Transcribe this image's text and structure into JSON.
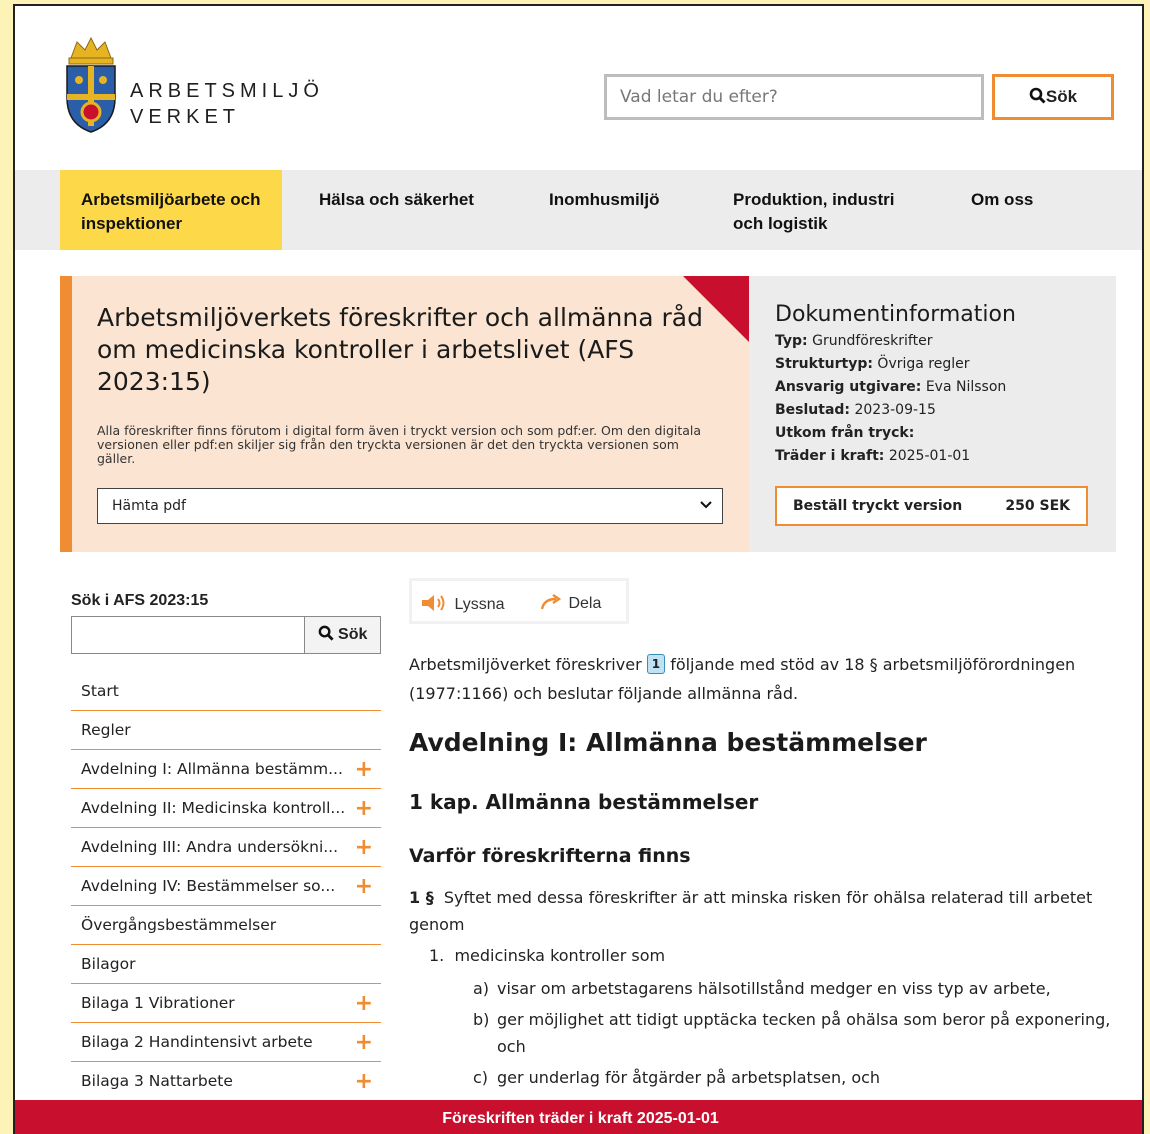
{
  "header": {
    "logo_line1": "ARBETSMILJÖ",
    "logo_line2": "VERKET",
    "search_placeholder": "Vad letar du efter?",
    "search_button": "Sök"
  },
  "nav": {
    "items": [
      {
        "label": "Arbetsmiljöarbete och inspektioner",
        "active": true
      },
      {
        "label": "Hälsa och säkerhet"
      },
      {
        "label": "Inomhusmiljö"
      },
      {
        "label": "Produktion, industri och logistik"
      },
      {
        "label": "Om oss"
      }
    ]
  },
  "document": {
    "title": "Arbetsmiljöverkets föreskrifter och allmänna råd om medicinska kontroller i arbetslivet (AFS 2023:15)",
    "note": "Alla föreskrifter finns förutom i digital form även i tryckt version och som pdf:er. Om den digitala versionen eller pdf:en skiljer sig från den tryckta versionen är det den tryckta versionen som gäller.",
    "pdf_select": "Hämta pdf"
  },
  "docinfo": {
    "heading": "Dokumentinformation",
    "rows": [
      {
        "label": "Typ:",
        "value": "Grundföreskrifter"
      },
      {
        "label": "Strukturtyp:",
        "value": "Övriga regler"
      },
      {
        "label": "Ansvarig utgivare:",
        "value": "Eva Nilsson"
      },
      {
        "label": "Beslutad:",
        "value": "2023-09-15"
      },
      {
        "label": "Utkom från tryck:",
        "value": ""
      },
      {
        "label": "Träder i kraft:",
        "value": "2025-01-01"
      }
    ],
    "order_label": "Beställ tryckt version",
    "order_price": "250 SEK"
  },
  "sidebar": {
    "title": "Sök i AFS 2023:15",
    "search_button": "Sök",
    "items": [
      {
        "label": "Start",
        "expandable": false
      },
      {
        "label": "Regler",
        "expandable": false
      },
      {
        "label": "Avdelning I: Allmänna bestämm...",
        "expandable": true
      },
      {
        "label": "Avdelning II: Medicinska kontroll...",
        "expandable": true
      },
      {
        "label": "Avdelning III: Andra undersökni...",
        "expandable": true
      },
      {
        "label": "Avdelning IV: Bestämmelser so...",
        "expandable": true
      },
      {
        "label": "Övergångsbestämmelser",
        "expandable": false
      },
      {
        "label": "Bilagor",
        "expandable": false
      },
      {
        "label": "Bilaga 1 Vibrationer",
        "expandable": true
      },
      {
        "label": "Bilaga 2 Handintensivt arbete",
        "expandable": true
      },
      {
        "label": "Bilaga 3 Nattarbete",
        "expandable": true
      }
    ]
  },
  "tools": {
    "listen": "Lyssna",
    "share": "Dela"
  },
  "content": {
    "intro_before": "Arbetsmiljöverket föreskriver",
    "intro_ref": "1",
    "intro_after": "följande med stöd av 18 § arbetsmiljöförordningen (1977:1166) och beslutar följande allmänna råd.",
    "h_avdelning": "Avdelning I: Allmänna bestämmelser",
    "h_kapitel": "1 kap. Allmänna bestämmelser",
    "h_varfor": "Varför föreskrifterna finns",
    "para_num": "1 §",
    "para_text": "Syftet med dessa föreskrifter är att minska risken för ohälsa relaterad till arbetet genom",
    "list1_marker": "1.",
    "list1_text": "medicinska kontroller som",
    "list2": [
      {
        "marker": "a)",
        "text": "visar om arbetstagarens hälsotillstånd medger en viss typ av arbete,"
      },
      {
        "marker": "b)",
        "text": "ger möjlighet att tidigt upptäcka tecken på ohälsa som beror på exponering, och"
      },
      {
        "marker": "c)",
        "text": "ger underlag för åtgärder på arbetsplatsen, och"
      }
    ]
  },
  "footer": {
    "text": "Föreskriften träder i kraft 2025-01-01"
  },
  "colors": {
    "accent_orange": "#f08c32",
    "nav_active": "#fdd94a",
    "banner_bg": "#fbe5d2",
    "brand_red": "#c8102e",
    "outer_bg": "#fdf3b6"
  }
}
